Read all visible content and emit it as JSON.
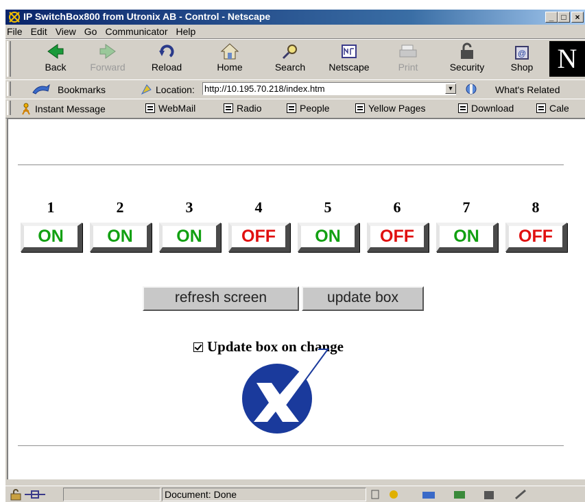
{
  "window": {
    "title": "IP SwitchBox800 from Utronix AB - Control - Netscape",
    "controls": {
      "minimize": "_",
      "maximize": "□",
      "close": "×"
    }
  },
  "menubar": {
    "items": [
      "File",
      "Edit",
      "View",
      "Go",
      "Communicator",
      "Help"
    ]
  },
  "navigation": {
    "buttons": [
      {
        "label": "Back",
        "icon": "back-arrow-icon",
        "enabled": true
      },
      {
        "label": "Forward",
        "icon": "forward-arrow-icon",
        "enabled": false
      },
      {
        "label": "Reload",
        "icon": "reload-icon",
        "enabled": true
      },
      {
        "label": "Home",
        "icon": "home-icon",
        "enabled": true
      },
      {
        "label": "Search",
        "icon": "search-icon",
        "enabled": true
      },
      {
        "label": "Netscape",
        "icon": "netscape-icon",
        "enabled": true
      },
      {
        "label": "Print",
        "icon": "print-icon",
        "enabled": false
      },
      {
        "label": "Security",
        "icon": "lock-icon",
        "enabled": true
      },
      {
        "label": "Shop",
        "icon": "shop-icon",
        "enabled": true
      }
    ],
    "logo": "N"
  },
  "location_bar": {
    "bookmarks_label": "Bookmarks",
    "location_label": "Location:",
    "url": "http://10.195.70.218/index.htm",
    "whats_related": "What's Related"
  },
  "personal_toolbar": {
    "items": [
      "Instant Message",
      "WebMail",
      "Radio",
      "People",
      "Yellow Pages",
      "Download",
      "Cale"
    ]
  },
  "switches": [
    {
      "number": "1",
      "state": "ON"
    },
    {
      "number": "2",
      "state": "ON"
    },
    {
      "number": "3",
      "state": "ON"
    },
    {
      "number": "4",
      "state": "OFF"
    },
    {
      "number": "5",
      "state": "ON"
    },
    {
      "number": "6",
      "state": "OFF"
    },
    {
      "number": "7",
      "state": "ON"
    },
    {
      "number": "8",
      "state": "OFF"
    }
  ],
  "colors": {
    "on": "#12a012",
    "off": "#e01010",
    "logo_blue": "#1a3a9c"
  },
  "form": {
    "refresh_label": "refresh screen",
    "update_label": "update box",
    "auto_update_label": "Update box on change",
    "auto_update_checked": true
  },
  "statusbar": {
    "text": "Document: Done"
  }
}
